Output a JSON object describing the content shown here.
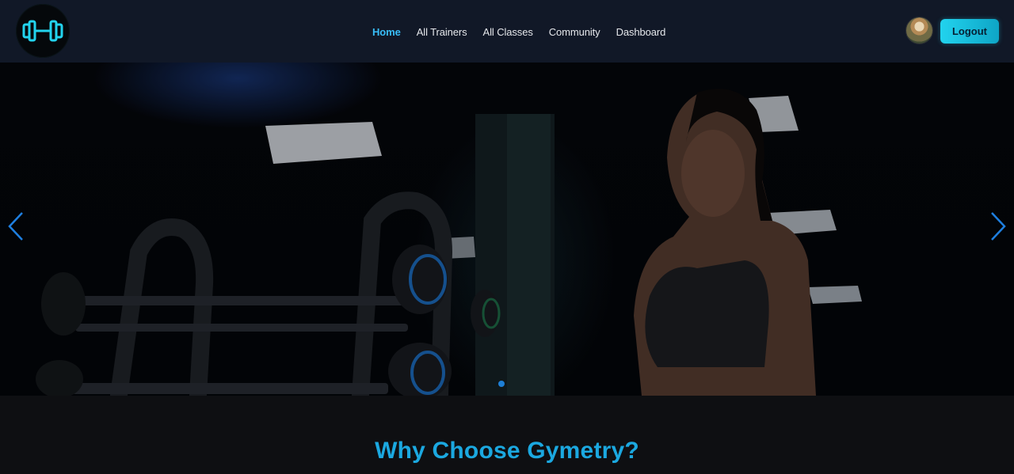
{
  "brand": {
    "logo_icon": "dumbbell-icon",
    "accent": "#22d3ee"
  },
  "nav": {
    "items": [
      {
        "label": "Home",
        "active": true
      },
      {
        "label": "All Trainers",
        "active": false
      },
      {
        "label": "All Classes",
        "active": false
      },
      {
        "label": "Community",
        "active": false
      },
      {
        "label": "Dashboard",
        "active": false
      }
    ]
  },
  "user": {
    "avatar_icon": "user-avatar",
    "logout_label": "Logout"
  },
  "hero": {
    "prev_icon": "chevron-left-icon",
    "next_icon": "chevron-right-icon",
    "slides_total": 1,
    "active_slide": 1
  },
  "section": {
    "title": "Why Choose Gymetry?",
    "title_color": "#1ba8e0"
  },
  "colors": {
    "header_bg": "#111827",
    "page_bg": "#0e0f12",
    "active_link": "#38bdf8"
  }
}
